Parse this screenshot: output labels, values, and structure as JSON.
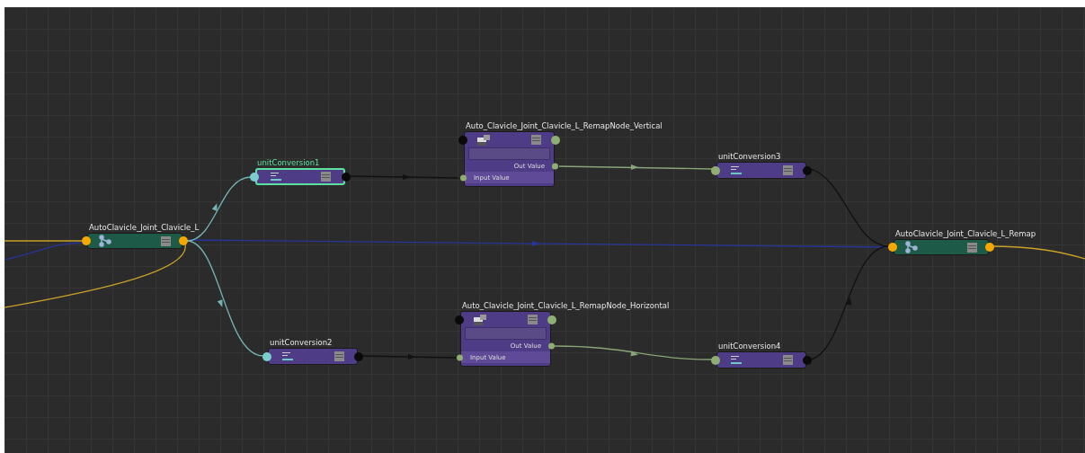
{
  "nodes": [
    {
      "kind": "transform",
      "title": "AutoClavicle_Joint_Clavicle_L",
      "selected": false
    },
    {
      "kind": "unit_conversion",
      "title": "unitConversion1",
      "selected": true,
      "color": "#7ccccc"
    },
    {
      "kind": "remap",
      "title": "Auto_Clavicle_Joint_Clavicle_L_RemapNode_Vertical",
      "selected": false,
      "attributes": [
        "Out Value",
        "Input Value"
      ]
    },
    {
      "kind": "unit_conversion",
      "title": "unitConversion3",
      "selected": false,
      "color": "#8fae74"
    },
    {
      "kind": "transform",
      "title": "AutoClavicle_Joint_Clavicle_L_Remap",
      "selected": false
    },
    {
      "kind": "unit_conversion",
      "title": "unitConversion2",
      "selected": false,
      "color": "#7ccccc"
    },
    {
      "kind": "remap",
      "title": "Auto_Clavicle_Joint_Clavicle_L_RemapNode_Horizontal",
      "selected": false,
      "attributes": [
        "Out Value",
        "Input Value"
      ]
    },
    {
      "kind": "unit_conversion",
      "title": "unitConversion4",
      "selected": false,
      "color": "#8fae74"
    }
  ]
}
